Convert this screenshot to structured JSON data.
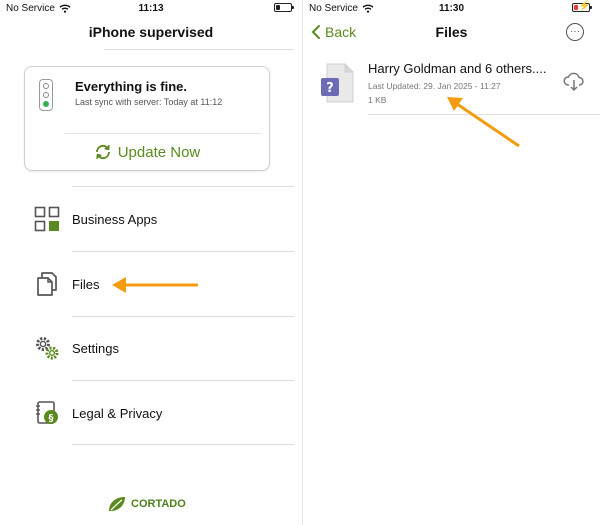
{
  "left_screen": {
    "status_bar": {
      "carrier": "No Service",
      "time": "11:13"
    },
    "title": "iPhone supervised",
    "status_card": {
      "headline": "Everything is fine.",
      "last_sync": "Last sync with server: Today at 11:12",
      "update_button": "Update Now"
    },
    "menu": [
      {
        "label": "Business Apps",
        "icon": "business-apps-grid-icon"
      },
      {
        "label": "Files",
        "icon": "files-copy-icon"
      },
      {
        "label": "Settings",
        "icon": "gears-icon"
      },
      {
        "label": "Legal & Privacy",
        "icon": "legal-paragraph-icon"
      }
    ],
    "brand": "CORTADO"
  },
  "right_screen": {
    "status_bar": {
      "carrier": "No Service",
      "time": "11:30",
      "battery_charging": true
    },
    "nav": {
      "back_label": "Back",
      "title": "Files",
      "more_icon": "ellipsis-circle-icon"
    },
    "files": [
      {
        "name": "Harry Goldman and 6 others....",
        "last_updated": "Last Updated: 29. Jan 2025 - 11:27",
        "size": "1 KB",
        "icon": "unknown-file-icon",
        "action_icon": "cloud-download-icon"
      }
    ]
  },
  "colors": {
    "accent_green": "#5a8a1f",
    "annotation_arrow": "#f39c12",
    "status_ok": "#37b24d"
  }
}
